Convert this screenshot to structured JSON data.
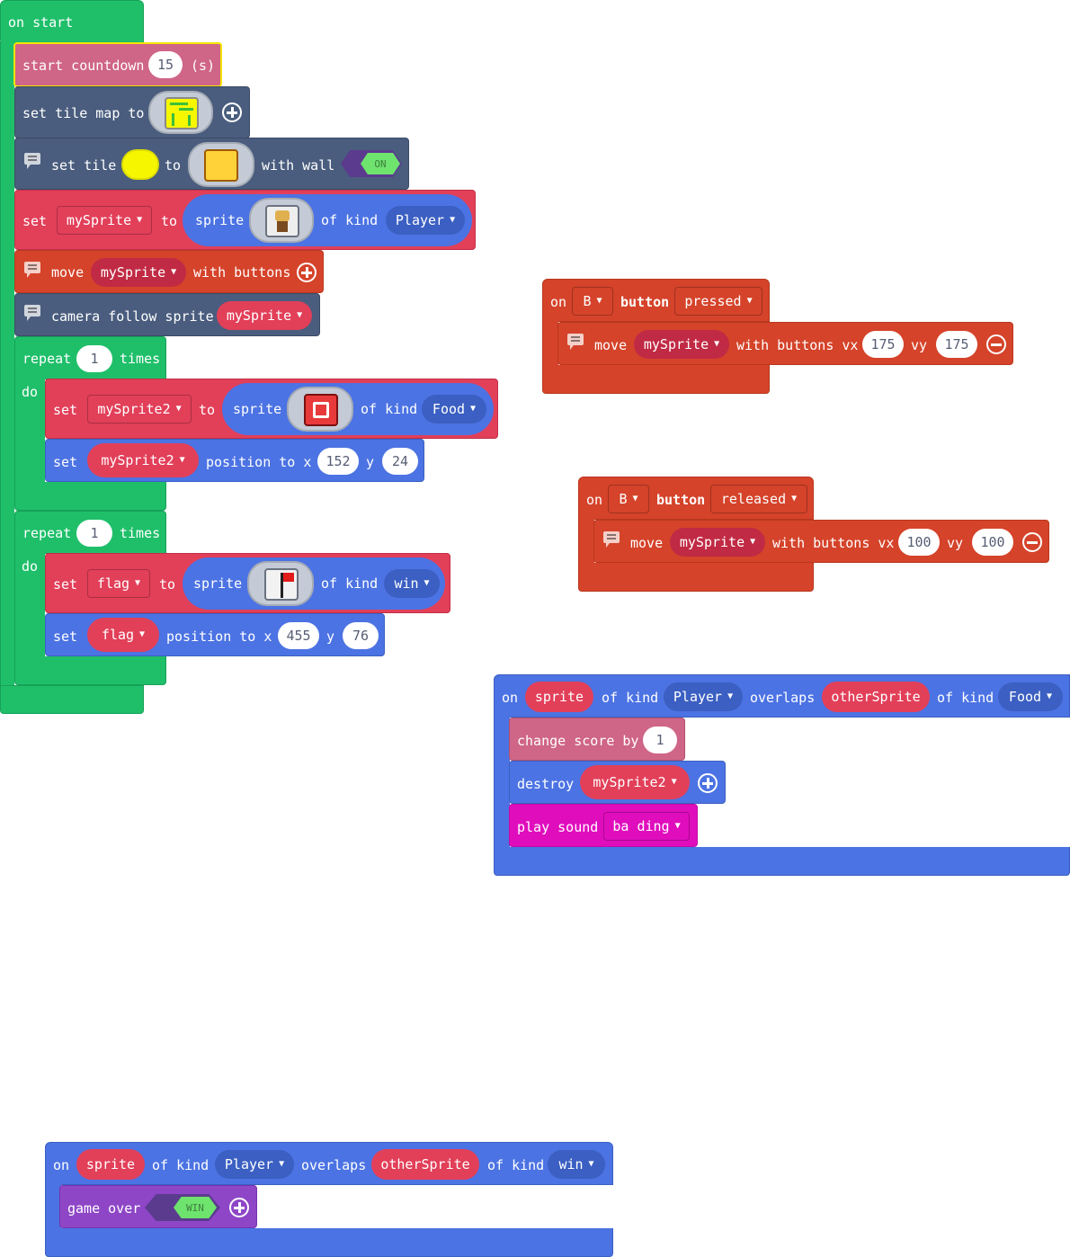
{
  "on_start": {
    "hat": "on start",
    "countdown": {
      "label": "start countdown",
      "value": "15",
      "unit": "(s)"
    },
    "tilemap": {
      "label": "set tile map to"
    },
    "set_tile": {
      "label_set": "set tile",
      "label_to": "to",
      "label_wall": "with wall",
      "wall_toggle": "ON"
    },
    "set_sprite": {
      "label_set": "set",
      "var": "mySprite",
      "label_to": "to",
      "label_sprite": "sprite",
      "label_ofkind": "of kind",
      "kind": "Player"
    },
    "move": {
      "label_move": "move",
      "var": "mySprite",
      "label_with": "with buttons"
    },
    "camera": {
      "label": "camera follow sprite",
      "var": "mySprite"
    },
    "repeat1": {
      "label_repeat": "repeat",
      "count": "1",
      "label_times": "times",
      "label_do": "do",
      "set_sprite": {
        "label_set": "set",
        "var": "mySprite2",
        "label_to": "to",
        "label_sprite": "sprite",
        "label_ofkind": "of kind",
        "kind": "Food"
      },
      "set_pos": {
        "label_set": "set",
        "var": "mySprite2",
        "label_pos": "position to x",
        "x": "152",
        "label_y": "y",
        "y": "24"
      }
    },
    "repeat2": {
      "label_repeat": "repeat",
      "count": "1",
      "label_times": "times",
      "label_do": "do",
      "set_sprite": {
        "label_set": "set",
        "var": "flag",
        "label_to": "to",
        "label_sprite": "sprite",
        "label_ofkind": "of kind",
        "kind": "win"
      },
      "set_pos": {
        "label_set": "set",
        "var": "flag",
        "label_pos": "position to x",
        "x": "455",
        "label_y": "y",
        "y": "76"
      }
    }
  },
  "b_pressed": {
    "label_on": "on",
    "button": "B",
    "label_button": "button",
    "event": "pressed",
    "move": {
      "label_move": "move",
      "var": "mySprite",
      "label_with": "with buttons vx",
      "vx": "175",
      "label_vy": "vy",
      "vy": "175"
    }
  },
  "b_released": {
    "label_on": "on",
    "button": "B",
    "label_button": "button",
    "event": "released",
    "move": {
      "label_move": "move",
      "var": "mySprite",
      "label_with": "with buttons vx",
      "vx": "100",
      "label_vy": "vy",
      "vy": "100"
    }
  },
  "overlap_food": {
    "label_on": "on",
    "sprite": "sprite",
    "label_ofkind": "of kind",
    "kind1": "Player",
    "label_overlaps": "overlaps",
    "other": "otherSprite",
    "label_ofkind2": "of kind",
    "kind2": "Food",
    "change_score": {
      "label": "change score by",
      "value": "1"
    },
    "destroy": {
      "label": "destroy",
      "var": "mySprite2"
    },
    "sound": {
      "label": "play sound",
      "value": "ba ding"
    }
  },
  "overlap_win": {
    "label_on": "on",
    "sprite": "sprite",
    "label_ofkind": "of kind",
    "kind1": "Player",
    "label_overlaps": "overlaps",
    "other": "otherSprite",
    "label_ofkind2": "of kind",
    "kind2": "win",
    "game_over": {
      "label": "game over",
      "toggle": "WIN"
    }
  },
  "colors": {
    "loops": "#1fbf6a",
    "info": "#cf6587",
    "scene": "#4a5d7e",
    "sprites": "#e23f59",
    "sprites_blue": "#4c73e3",
    "controller": "#d5432a",
    "music": "#e00dbd",
    "game": "#8e46c7"
  }
}
